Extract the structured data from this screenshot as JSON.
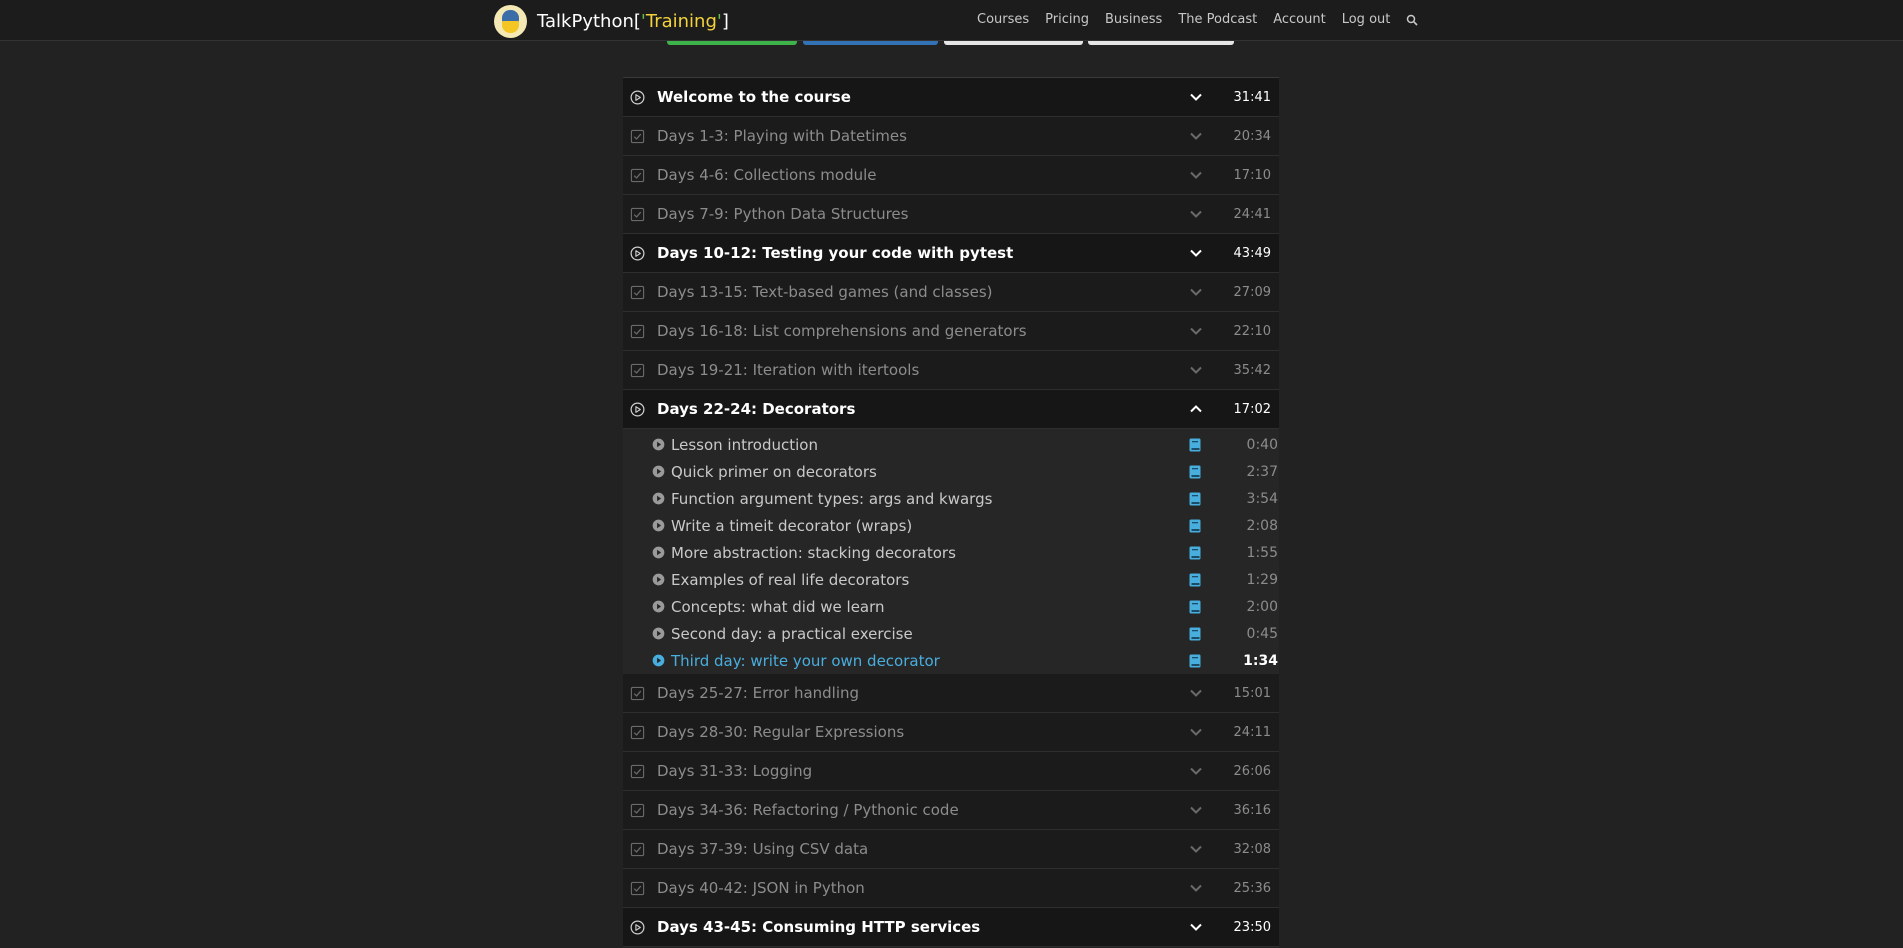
{
  "brand": {
    "prefix": "TalkPython[",
    "quote_open": "'",
    "name": "Training",
    "quote_close": "'",
    "suffix": "]"
  },
  "nav": {
    "courses": "Courses",
    "pricing": "Pricing",
    "business": "Business",
    "podcast": "The Podcast",
    "account": "Account",
    "logout": "Log out"
  },
  "colors": {
    "tab_green": "#3db34a",
    "tab_blue": "#3372b5",
    "tab_white": "#e6e6e6",
    "accent_blue": "#48aede"
  },
  "chapters_before": [
    {
      "title": "Welcome to the course",
      "duration": "31:41",
      "state": "active",
      "icon": "play-circle-icon"
    },
    {
      "title": "Days 1-3: Playing with Datetimes",
      "duration": "20:34",
      "state": "done",
      "icon": "checkbox-icon"
    },
    {
      "title": "Days 4-6: Collections module",
      "duration": "17:10",
      "state": "done",
      "icon": "checkbox-icon"
    },
    {
      "title": "Days 7-9: Python Data Structures",
      "duration": "24:41",
      "state": "done",
      "icon": "checkbox-icon"
    },
    {
      "title": "Days 10-12: Testing your code with pytest",
      "duration": "43:49",
      "state": "active",
      "icon": "play-circle-icon"
    },
    {
      "title": "Days 13-15: Text-based games (and classes)",
      "duration": "27:09",
      "state": "done",
      "icon": "checkbox-icon"
    },
    {
      "title": "Days 16-18: List comprehensions and generators",
      "duration": "22:10",
      "state": "done",
      "icon": "checkbox-icon"
    },
    {
      "title": "Days 19-21: Iteration with itertools",
      "duration": "35:42",
      "state": "done",
      "icon": "checkbox-icon"
    }
  ],
  "expanded_chapter": {
    "title": "Days 22-24: Decorators",
    "duration": "17:02",
    "lessons": [
      {
        "title": "Lesson introduction",
        "duration": "0:40"
      },
      {
        "title": "Quick primer on decorators",
        "duration": "2:37"
      },
      {
        "title": "Function argument types: args and kwargs",
        "duration": "3:54"
      },
      {
        "title": "Write a timeit decorator (wraps)",
        "duration": "2:08"
      },
      {
        "title": "More abstraction: stacking decorators",
        "duration": "1:55"
      },
      {
        "title": "Examples of real life decorators",
        "duration": "1:29"
      },
      {
        "title": "Concepts: what did we learn",
        "duration": "2:00"
      },
      {
        "title": "Second day: a practical exercise",
        "duration": "0:45"
      },
      {
        "title": "Third day: write your own decorator",
        "duration": "1:34"
      }
    ]
  },
  "chapters_after": [
    {
      "title": "Days 25-27: Error handling",
      "duration": "15:01",
      "state": "done",
      "icon": "checkbox-icon"
    },
    {
      "title": "Days 28-30: Regular Expressions",
      "duration": "24:11",
      "state": "done",
      "icon": "checkbox-icon"
    },
    {
      "title": "Days 31-33: Logging",
      "duration": "26:06",
      "state": "done",
      "icon": "checkbox-icon"
    },
    {
      "title": "Days 34-36: Refactoring / Pythonic code",
      "duration": "36:16",
      "state": "done",
      "icon": "checkbox-icon"
    },
    {
      "title": "Days 37-39: Using CSV data",
      "duration": "32:08",
      "state": "done",
      "icon": "checkbox-icon"
    },
    {
      "title": "Days 40-42: JSON in Python",
      "duration": "25:36",
      "state": "done",
      "icon": "checkbox-icon"
    },
    {
      "title": "Days 43-45: Consuming HTTP services",
      "duration": "23:50",
      "state": "active",
      "icon": "play-circle-icon"
    }
  ]
}
